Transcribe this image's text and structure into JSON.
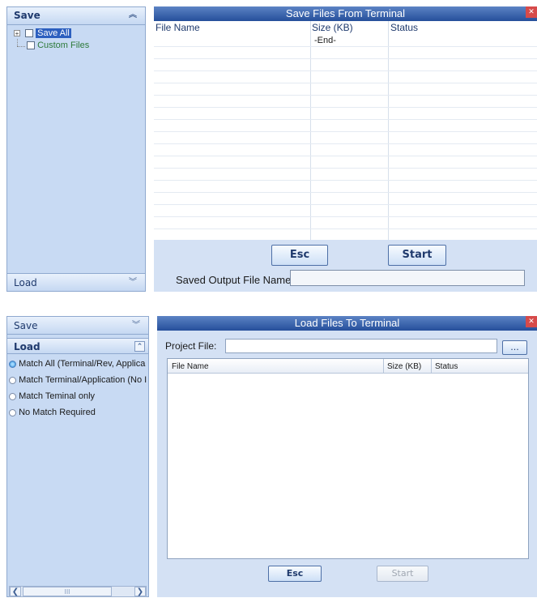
{
  "top": {
    "nav_save_header": "Save",
    "nav_load_header": "Load",
    "tree": [
      {
        "label": "Save All",
        "selected": true,
        "has_expander": true
      },
      {
        "label": "Custom Files",
        "selected": false,
        "has_expander": false
      }
    ],
    "title": "Save Files From Terminal",
    "columns": [
      "File Name",
      "Size (KB)",
      "Status"
    ],
    "rows": [
      {
        "file_name": "",
        "size": "-End-",
        "status": ""
      }
    ],
    "esc_label": "Esc",
    "start_label": "Start",
    "output_label": "Saved Output File Name",
    "output_value": ""
  },
  "bottom": {
    "nav_save_header": "Save",
    "nav_load_header": "Load",
    "radios": [
      {
        "label": "Match All (Terminal/Rev, Applica",
        "checked": true
      },
      {
        "label": "Match Terminal/Application (No I",
        "checked": false
      },
      {
        "label": "Match Teminal only",
        "checked": false
      },
      {
        "label": "No Match Required",
        "checked": false
      }
    ],
    "title": "Load Files To Terminal",
    "project_file_label": "Project File:",
    "project_file_value": "",
    "browse_label": "...",
    "columns": [
      "File Name",
      "Size (KB)",
      "Status"
    ],
    "esc_label": "Esc",
    "start_label": "Start",
    "scroll_thumb_label": "III"
  },
  "colors": {
    "panel_bg": "#c8daf3",
    "title_bg": "#254f9b",
    "tree_selected": "#2c5fbf",
    "custom_files_text": "#2d7a3a"
  }
}
